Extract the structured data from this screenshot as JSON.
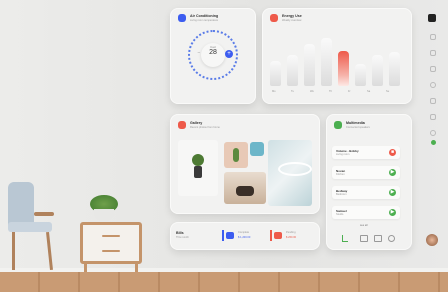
{
  "air_conditioning": {
    "title": "Air Conditioning",
    "subtitle": "Living room temperature",
    "mode": "Cool",
    "temperature": "28",
    "minus": "−",
    "plus": "+"
  },
  "energy": {
    "title": "Energy Use",
    "subtitle": "Weekly overview",
    "levels": [
      0.45,
      0.55,
      0.75,
      0.85,
      0.62,
      0.4,
      0.55,
      0.6
    ],
    "highlight_index": 4,
    "days": [
      "Mo",
      "Tu",
      "We",
      "Th",
      "Fr",
      "Sa",
      "Su"
    ]
  },
  "gallery": {
    "title": "Gallery",
    "subtitle": "Recent photos from home"
  },
  "multimedia": {
    "title": "Multimedia",
    "subtitle": "Connected speakers",
    "items": [
      {
        "name": "Volume - Bobby",
        "sub": "Living room",
        "color": "#ee5a4a",
        "symbol": "■"
      },
      {
        "name": "Nocan",
        "sub": "Kitchen",
        "color": "#4caf50",
        "symbol": "▶"
      },
      {
        "name": "Bedway",
        "sub": "Bedroom",
        "color": "#4caf50",
        "symbol": "▶"
      },
      {
        "name": "Samuel",
        "sub": "Studio",
        "color": "#4caf50",
        "symbol": "▶"
      }
    ],
    "see_all": "see all"
  },
  "bills": {
    "title": "Bills",
    "subtitle": "This month",
    "completed_label": "Complete",
    "completed_value": "$ 1,200.00",
    "pending_label": "Pending",
    "pending_value": "$ 260.00"
  },
  "colors": {
    "accent": "#3d5df0",
    "red": "#ee5a4a",
    "green": "#4caf50"
  },
  "sidebar": {
    "icons": [
      "app-logo",
      "home-icon",
      "grid-icon",
      "chart-icon",
      "bulb-icon",
      "camera-icon",
      "lock-icon",
      "settings-icon",
      "leaf-icon"
    ]
  }
}
